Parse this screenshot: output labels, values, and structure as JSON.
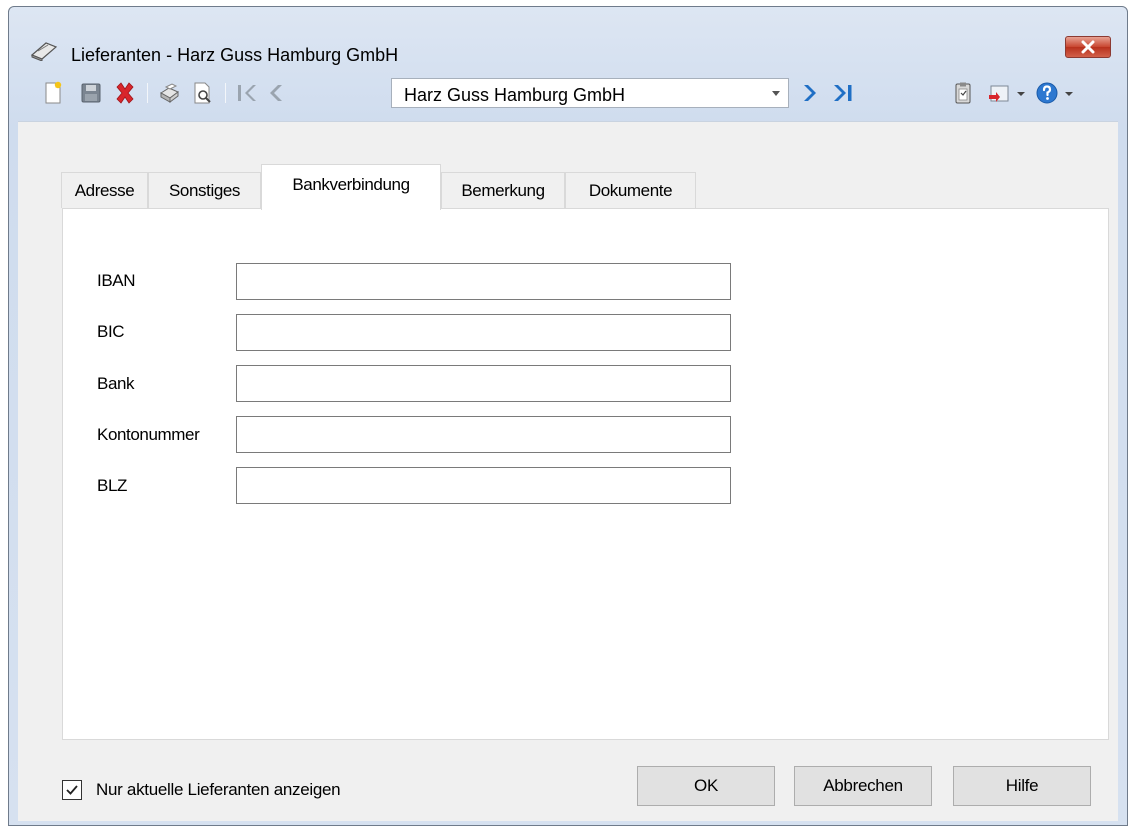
{
  "window": {
    "title": "Lieferanten - Harz Guss Hamburg GmbH",
    "close_symbol": "✕"
  },
  "toolbar": {
    "icons": [
      "new-document-icon",
      "save-icon",
      "delete-icon",
      "print-icon",
      "print-preview-icon",
      "first-record-icon",
      "previous-record-icon",
      "next-record-icon",
      "last-record-icon",
      "clipboard-icon",
      "export-icon",
      "help-icon"
    ],
    "record_selector": {
      "value": "Harz Guss Hamburg GmbH"
    }
  },
  "tabs": [
    {
      "label": "Adresse",
      "active": false
    },
    {
      "label": "Sonstiges",
      "active": false
    },
    {
      "label": "Bankverbindung",
      "active": true
    },
    {
      "label": "Bemerkung",
      "active": false
    },
    {
      "label": "Dokumente",
      "active": false
    }
  ],
  "bank": {
    "fields": [
      {
        "label": "IBAN",
        "value": ""
      },
      {
        "label": "BIC",
        "value": ""
      },
      {
        "label": "Bank",
        "value": ""
      },
      {
        "label": "Kontonummer",
        "value": ""
      },
      {
        "label": "BLZ",
        "value": ""
      }
    ]
  },
  "footer": {
    "checkbox_label": "Nur aktuelle Lieferanten anzeigen",
    "checkbox_checked": true,
    "ok_label": "OK",
    "cancel_label": "Abbrechen",
    "help_label": "Hilfe"
  },
  "colors": {
    "titlebar": "#cfdcee",
    "close_button": "#c8452f",
    "nav_arrow": "#1f6fc5",
    "delete_red": "#d8262c",
    "help_blue": "#2d78d0"
  }
}
